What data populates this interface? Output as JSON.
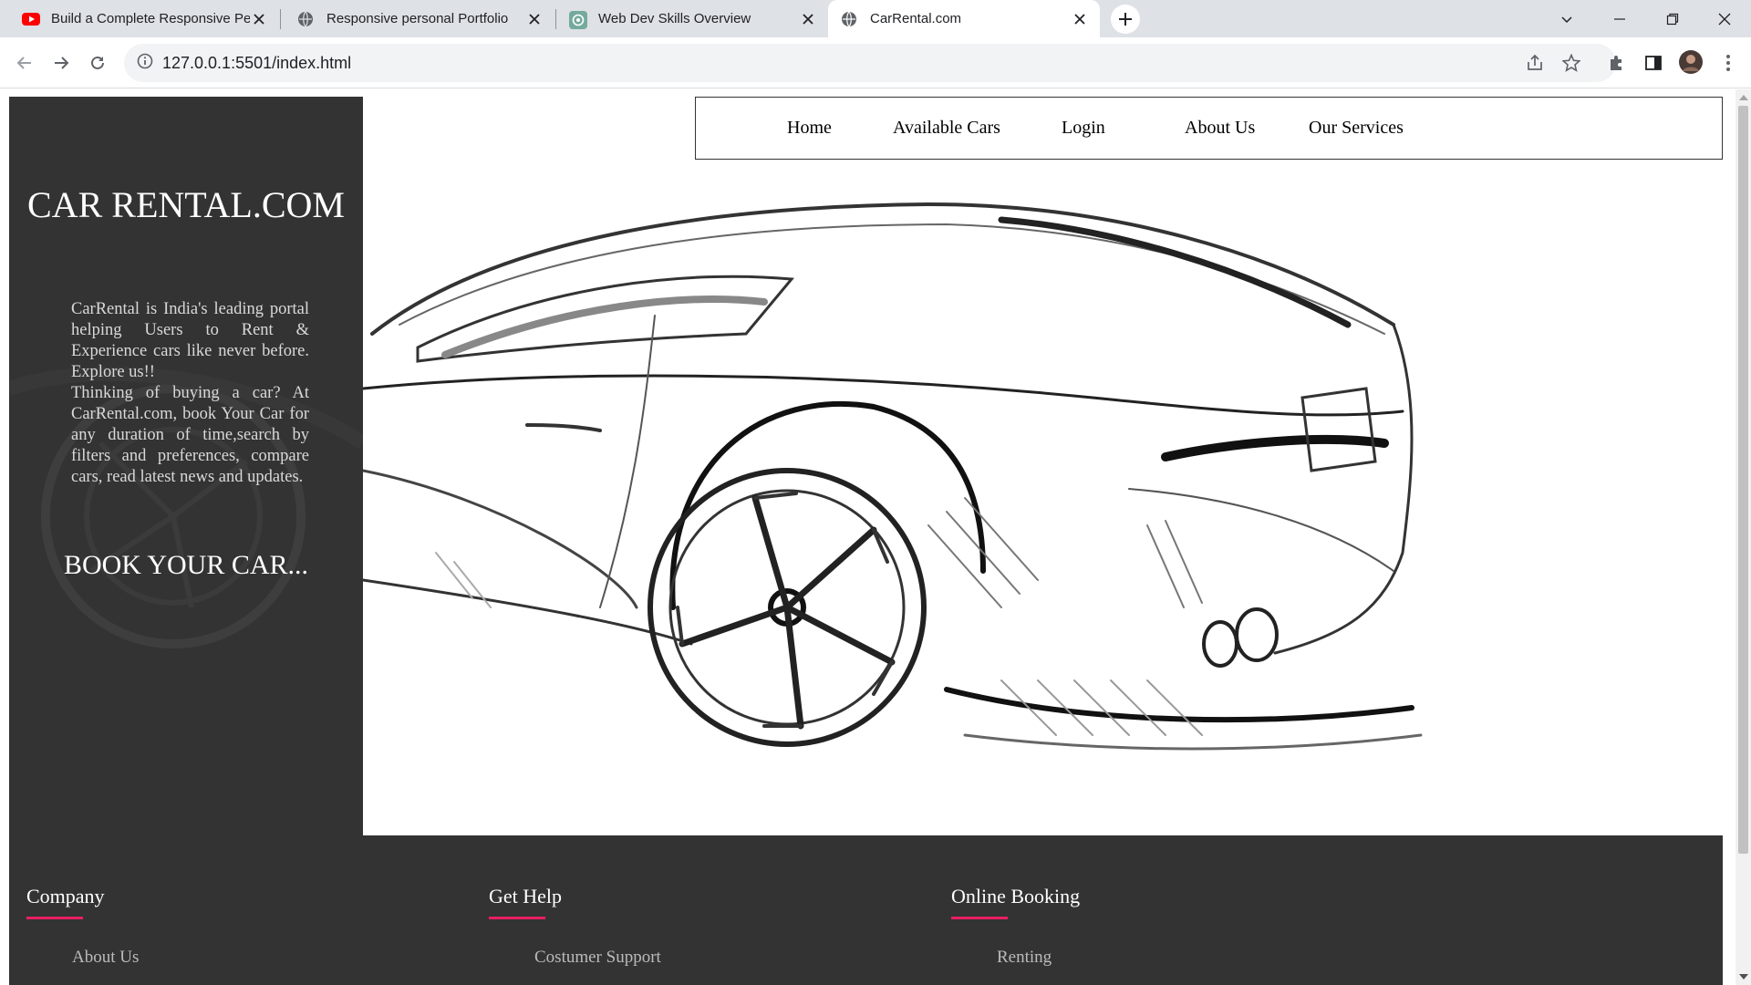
{
  "browser": {
    "tabs": [
      {
        "title": "Build a Complete Responsive Per",
        "icon": "youtube-icon",
        "active": false
      },
      {
        "title": "Responsive personal Portfolio",
        "icon": "globe-icon",
        "active": false
      },
      {
        "title": "Web Dev Skills Overview",
        "icon": "chatgpt-icon",
        "active": false
      },
      {
        "title": "CarRental.com",
        "icon": "globe-icon",
        "active": true
      }
    ],
    "url": "127.0.0.1:5501/index.html"
  },
  "sidebar": {
    "brand": "CAR RENTAL.COM",
    "intro": "CarRental is India's leading portal helping Users to Rent & Experience cars like never before. Explore us!!",
    "intro2": "Thinking of buying a car? At CarRental.com, book Your Car for any duration of time,search by filters and preferences, compare cars, read latest news and updates.",
    "cta": "BOOK YOUR CAR..."
  },
  "nav": {
    "links": [
      "Home",
      "Available Cars",
      "Login",
      "About Us",
      "Our Services"
    ]
  },
  "footer": {
    "columns": [
      {
        "heading": "Company",
        "first_link": "About Us"
      },
      {
        "heading": "Get Help",
        "first_link": "Costumer Support"
      },
      {
        "heading": "Online Booking",
        "first_link": "Renting"
      }
    ],
    "accent_color": "#e91e63"
  },
  "colors": {
    "panel": "#333333",
    "page_bg": "#ffffff"
  }
}
